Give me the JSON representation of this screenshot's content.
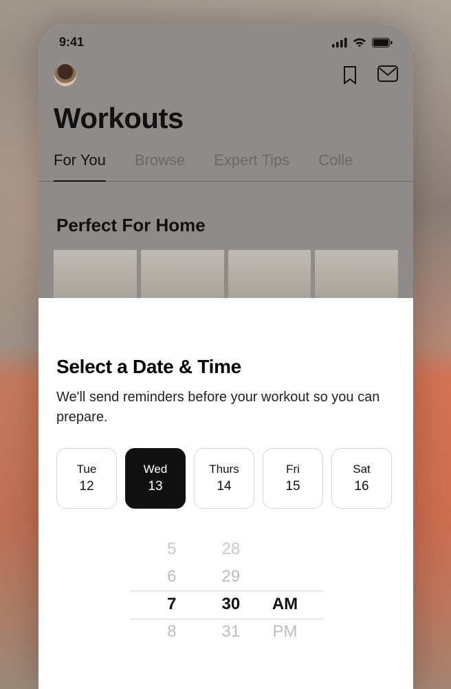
{
  "status": {
    "time": "9:41"
  },
  "page": {
    "title": "Workouts"
  },
  "tabs": [
    {
      "label": "For You",
      "active": true
    },
    {
      "label": "Browse",
      "active": false
    },
    {
      "label": "Expert Tips",
      "active": false
    },
    {
      "label": "Colle",
      "active": false
    }
  ],
  "section": {
    "title": "Perfect For Home"
  },
  "sheet": {
    "title": "Select a Date & Time",
    "description": "We'll send reminders before your workout so you can prepare.",
    "dates": [
      {
        "day": "Tue",
        "num": "12",
        "selected": false
      },
      {
        "day": "Wed",
        "num": "13",
        "selected": true
      },
      {
        "day": "Thurs",
        "num": "14",
        "selected": false
      },
      {
        "day": "Fri",
        "num": "15",
        "selected": false
      },
      {
        "day": "Sat",
        "num": "16",
        "selected": false
      }
    ],
    "time": {
      "hours_far": "5",
      "hours_near": "6",
      "hours_selected": "7",
      "hours_after_near": "8",
      "minutes_far": "28",
      "minutes_near": "29",
      "minutes_selected": "30",
      "minutes_after_near": "31",
      "ampm_selected": "AM",
      "ampm_after": "PM"
    }
  }
}
